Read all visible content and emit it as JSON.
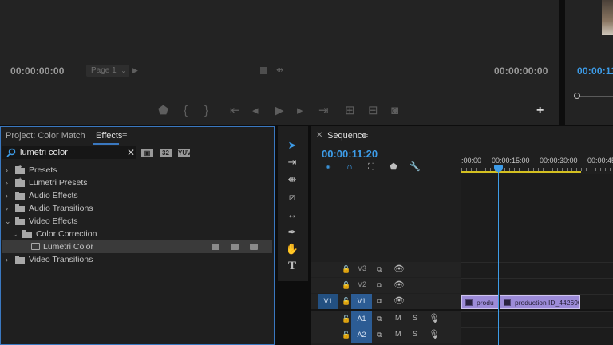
{
  "source_monitor": {
    "timecode_left": "00:00:00:00",
    "timecode_right": "00:00:00:00",
    "page_dropdown": "Page 1"
  },
  "program_monitor": {
    "timecode": "00:00:11"
  },
  "effects_panel": {
    "tab_project": "Project: Color Match",
    "tab_effects": "Effects",
    "search_value": "lumetri color",
    "filter_buttons": [
      "32",
      "YUV"
    ],
    "tree": [
      {
        "label": "Presets",
        "kind": "preset-folder",
        "expanded": false
      },
      {
        "label": "Lumetri Presets",
        "kind": "preset-folder",
        "expanded": false
      },
      {
        "label": "Audio Effects",
        "kind": "folder",
        "expanded": false
      },
      {
        "label": "Audio Transitions",
        "kind": "folder",
        "expanded": false
      },
      {
        "label": "Video Effects",
        "kind": "folder",
        "expanded": true
      },
      {
        "label": "Color Correction",
        "kind": "folder",
        "expanded": true
      },
      {
        "label": "Lumetri Color",
        "kind": "effect",
        "selected": true
      },
      {
        "label": "Video Transitions",
        "kind": "folder",
        "expanded": false
      }
    ]
  },
  "timeline": {
    "title": "Sequence",
    "timecode": "00:00:11:20",
    "ruler_labels": [
      ":00:00",
      "00:00:15:00",
      "00:00:30:00",
      "00:00:45"
    ],
    "tracks": [
      {
        "name": "V3",
        "type": "video"
      },
      {
        "name": "V2",
        "type": "video"
      },
      {
        "name": "V1",
        "type": "video",
        "source": "V1"
      },
      {
        "name": "A1",
        "type": "audio",
        "mute": "M",
        "solo": "S"
      },
      {
        "name": "A2",
        "type": "audio",
        "mute": "M",
        "solo": "S"
      }
    ],
    "clips": [
      {
        "name": "produ",
        "track": "V1"
      },
      {
        "name": "production ID_442690",
        "track": "V1"
      }
    ]
  },
  "colors": {
    "accent": "#3d9ce8",
    "panel": "#1f1f1f",
    "clip": "#9c8bd8",
    "work_area": "#d4c020"
  }
}
